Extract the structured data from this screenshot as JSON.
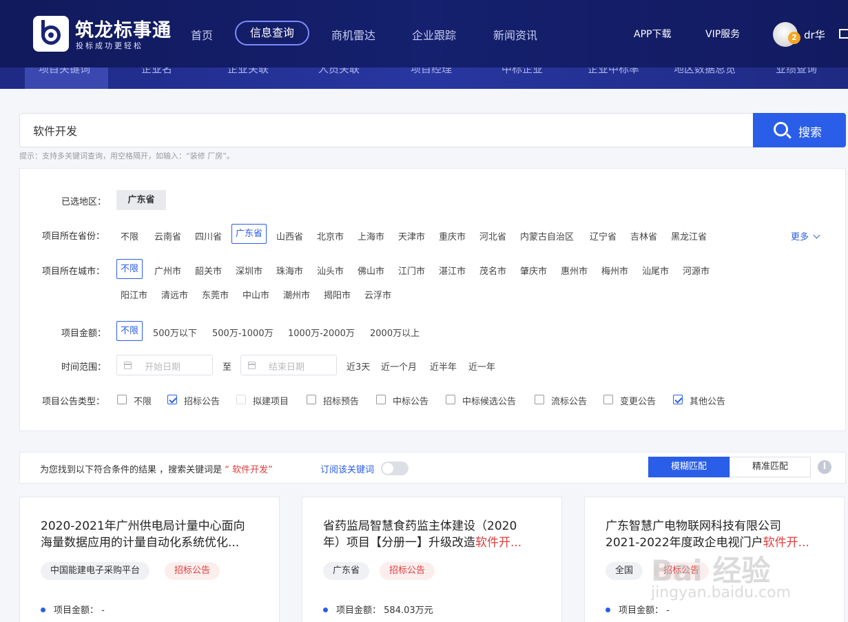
{
  "brand": {
    "name": "筑龙标事通",
    "slogan": "投标成功更轻松"
  },
  "nav": {
    "items": [
      "首页",
      "信息查询",
      "商机雷达",
      "企业跟踪",
      "新闻资讯"
    ],
    "active": "信息查询",
    "right": [
      "APP下载",
      "VIP服务"
    ]
  },
  "user": {
    "name": "dr华",
    "badge": "2"
  },
  "subnav": [
    "项目关键词",
    "企业名",
    "企业关联",
    "人员关联",
    "项目经理",
    "中标企业",
    "企业中标率",
    "地区数据总览",
    "业绩查询"
  ],
  "search": {
    "value": "软件开发",
    "button": "搜索",
    "hint": "提示：支持多关键词查询，用空格隔开，如输入：“装修 厂房”。"
  },
  "filters": {
    "region_label": "已选地区：",
    "region_chip": "广东省",
    "province_label": "项目所在省份：",
    "provinces": [
      "不限",
      "云南省",
      "四川省",
      "广东省",
      "山西省",
      "北京市",
      "上海市",
      "天津市",
      "重庆市",
      "河北省",
      "内蒙古自治区",
      "辽宁省",
      "吉林省",
      "黑龙江省"
    ],
    "province_selected": "广东省",
    "more": "更多",
    "city_label": "项目所在城市：",
    "cities_row1": [
      "不限",
      "广州市",
      "韶关市",
      "深圳市",
      "珠海市",
      "汕头市",
      "佛山市",
      "江门市",
      "湛江市",
      "茂名市",
      "肇庆市",
      "惠州市",
      "梅州市",
      "汕尾市",
      "河源市"
    ],
    "cities_row2": [
      "阳江市",
      "清远市",
      "东莞市",
      "中山市",
      "潮州市",
      "揭阳市",
      "云浮市"
    ],
    "city_selected": "不限",
    "amount_label": "项目金额：",
    "amounts": [
      "不限",
      "500万以下",
      "500万-1000万",
      "1000万-2000万",
      "2000万以上"
    ],
    "amount_selected": "不限",
    "time_label": "时间范围：",
    "start_placeholder": "开始日期",
    "to": "至",
    "end_placeholder": "结束日期",
    "time_quick": [
      "近3天",
      "近一个月",
      "近半年",
      "近一年"
    ],
    "type_label": "项目公告类型：",
    "types": [
      {
        "label": "不限",
        "checked": false
      },
      {
        "label": "招标公告",
        "checked": true
      },
      {
        "label": "拟建项目",
        "checked": false
      },
      {
        "label": "招标预告",
        "checked": false
      },
      {
        "label": "中标公告",
        "checked": false
      },
      {
        "label": "中标候选公告",
        "checked": false
      },
      {
        "label": "流标公告",
        "checked": false
      },
      {
        "label": "变更公告",
        "checked": false
      },
      {
        "label": "其他公告",
        "checked": true
      }
    ]
  },
  "results": {
    "prefix": "为您找到以下符合条件的结果 ，搜索关键词是",
    "keyword": "“ 软件开发”",
    "subscribe": "订阅该关键词",
    "fuzzy": "模糊匹配",
    "exact": "精准匹配",
    "info": "i"
  },
  "cards": [
    {
      "line1": "2020-2021年广州供电局计量中心面向",
      "line2": "海量数据应用的计量自动化系统优化...",
      "hl": "",
      "tag1": "中国能建电子采购平台",
      "tag2": "招标公告",
      "amount_label": "项目金额：",
      "amount": "-"
    },
    {
      "line1": "省药监局智慧食药监主体建设（2020",
      "line2": "年）项目【分册一】升级改造",
      "hl": "软件开...",
      "tag1": "广东省",
      "tag2": "招标公告",
      "amount_label": "项目金额：",
      "amount": "584.03万元"
    },
    {
      "line1": "广东智慧广电物联网科技有限公司",
      "line2": "2021-2022年度政企电视门户",
      "hl": "软件开...",
      "tag1": "全国",
      "tag2": "招标公告",
      "amount_label": "项目金额：",
      "amount": "-"
    }
  ],
  "watermark": {
    "text": "Bai 经验",
    "sub": "jingyan.baidu.com"
  }
}
